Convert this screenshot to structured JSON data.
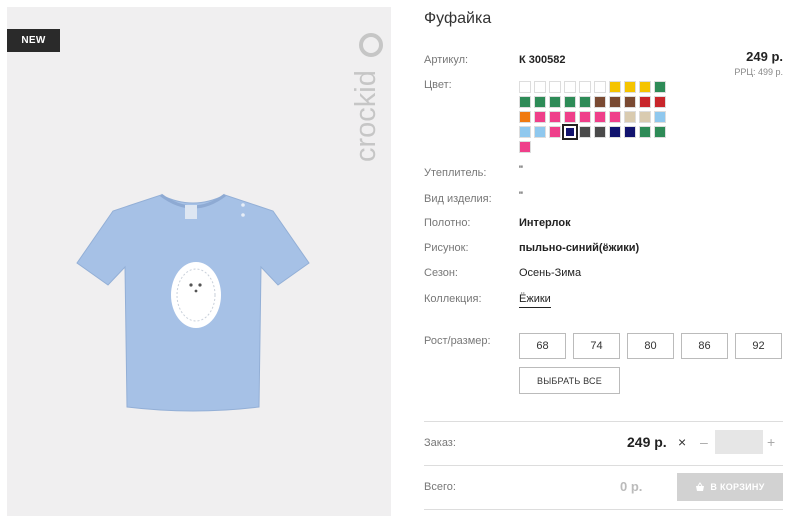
{
  "product": {
    "badge": "NEW",
    "brand": "crockid",
    "title": "Фуфайка",
    "price": "249 р.",
    "rrp": "РРЦ: 499 р."
  },
  "attributes": [
    {
      "label": "Артикул:",
      "value": "К 300582",
      "bold": true
    },
    {
      "label": "Цвет:",
      "value": ""
    },
    {
      "label": "Утеплитель:",
      "value": "\""
    },
    {
      "label": "Вид изделия:",
      "value": "\""
    },
    {
      "label": "Полотно:",
      "value": "Интерлок",
      "bold": true
    },
    {
      "label": "Рисунок:",
      "value": "пыльно-синий(ёжики)",
      "bold": true
    },
    {
      "label": "Сезон:",
      "value": "Осень-Зима"
    },
    {
      "label": "Коллекция:",
      "value": "Ёжики"
    }
  ],
  "colors": [
    "#ffffff",
    "#ffffff",
    "#ffffff",
    "#ffffff",
    "#ffffff",
    "#ffffff",
    "#f5c400",
    "#f5c400",
    "#f5c400",
    "#2e8b57",
    "#2e8b57",
    "#2e8b57",
    "#2e8b57",
    "#2e8b57",
    "#2e8b57",
    "#7a4a32",
    "#7a4a32",
    "#7a4a32",
    "#c8262b",
    "#c8262b",
    "#f07a10",
    "#ef3f8a",
    "#ef3f8a",
    "#ef3f8a",
    "#ef3f8a",
    "#ef3f8a",
    "#ef3f8a",
    "#d9cbb0",
    "#d9cbb0",
    "#8fc8ee",
    "#8fc8ee",
    "#8fc8ee",
    "#ef3f8a",
    "#11136e",
    "#4a4a4a",
    "#4a4a4a",
    "#11136e",
    "#11136e",
    "#2e8b57",
    "#2e8b57",
    "#ef3f8a"
  ],
  "selected_color_index": 33,
  "sizes_label": "Рост/размер:",
  "sizes": [
    "68",
    "74",
    "80",
    "86",
    "92"
  ],
  "select_all": "ВЫБРАТЬ ВСЕ",
  "order": {
    "label": "Заказ:",
    "price": "249 р.",
    "times": "×",
    "minus": "–",
    "plus": "+",
    "qty": ""
  },
  "total": {
    "label": "Всего:",
    "value": "0 р.",
    "cart_button": "В КОРЗИНУ"
  }
}
